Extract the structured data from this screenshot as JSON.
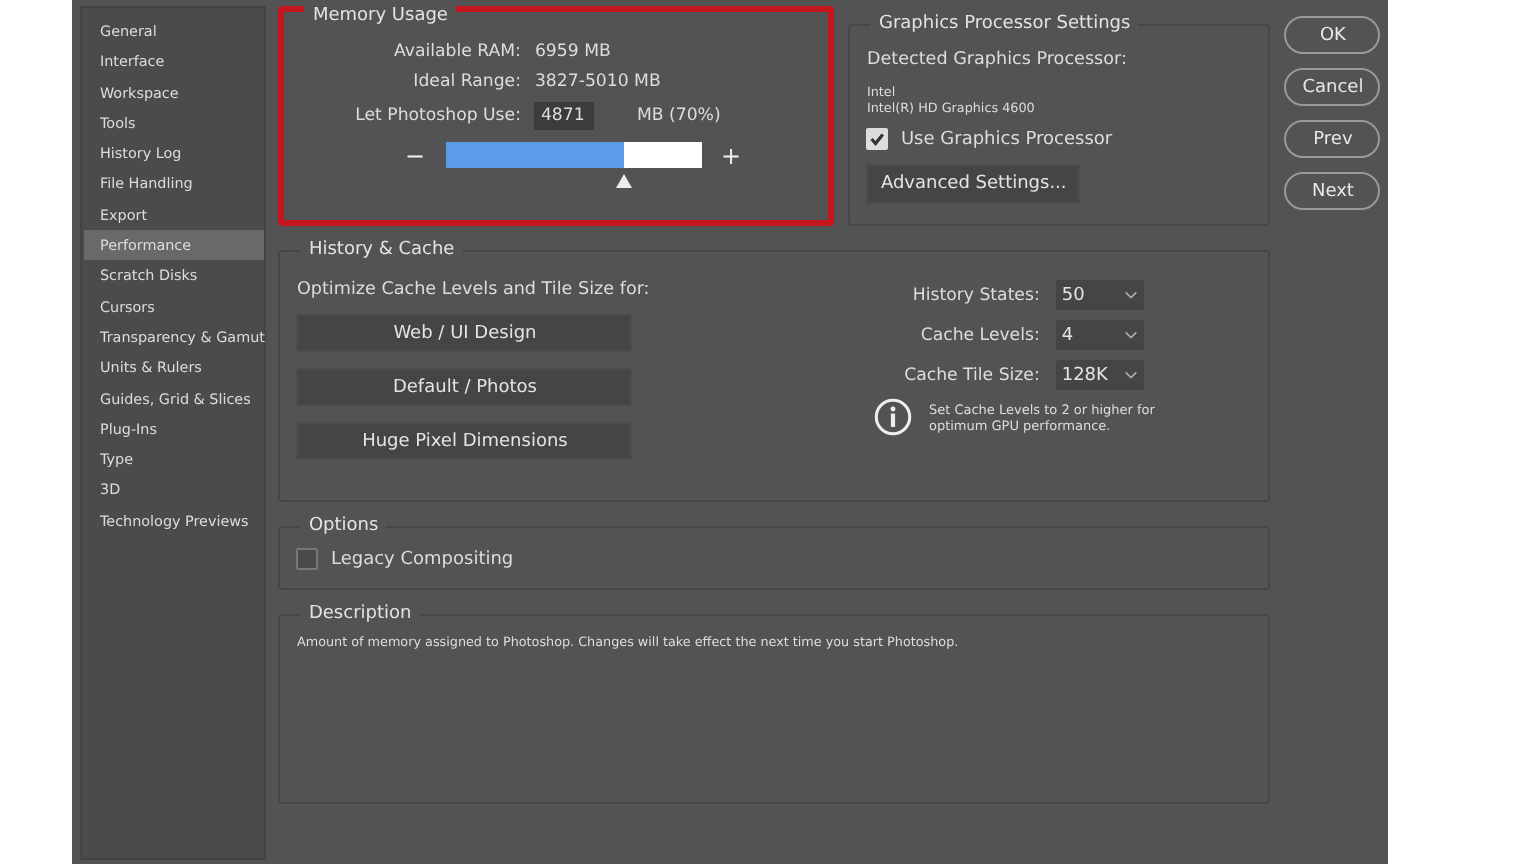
{
  "sidebar": {
    "items": [
      {
        "label": "General",
        "selected": false
      },
      {
        "label": "Interface",
        "selected": false
      },
      {
        "label": "Workspace",
        "selected": false
      },
      {
        "label": "Tools",
        "selected": false
      },
      {
        "label": "History Log",
        "selected": false
      },
      {
        "label": "File Handling",
        "selected": false
      },
      {
        "label": "Export",
        "selected": false
      },
      {
        "label": "Performance",
        "selected": true
      },
      {
        "label": "Scratch Disks",
        "selected": false
      },
      {
        "label": "Cursors",
        "selected": false
      },
      {
        "label": "Transparency & Gamut",
        "selected": false
      },
      {
        "label": "Units & Rulers",
        "selected": false
      },
      {
        "label": "Guides, Grid & Slices",
        "selected": false
      },
      {
        "label": "Plug-Ins",
        "selected": false
      },
      {
        "label": "Type",
        "selected": false
      },
      {
        "label": "3D",
        "selected": false
      },
      {
        "label": "Technology Previews",
        "selected": false
      }
    ]
  },
  "memory_usage": {
    "title": "Memory Usage",
    "highlighted": true,
    "rows": [
      {
        "label": "Available RAM:",
        "value": "6959 MB"
      },
      {
        "label": "Ideal Range:",
        "value": "3827-5010 MB"
      }
    ],
    "use_label": "Let Photoshop Use:",
    "use_value": "4871",
    "use_unit": "MB (70%)",
    "minus": "−",
    "plus": "+",
    "level": 0.7
  },
  "graphics_processor": {
    "title": "Graphics Processor Settings",
    "detected_label": "Detected Graphics Processor:",
    "vendor": "Intel",
    "model": "Intel(R) HD Graphics 4600",
    "use_gpu": {
      "label": "Use Graphics Processor",
      "checked": true
    },
    "advanced_button": "Advanced Settings..."
  },
  "buttons": [
    "OK",
    "Cancel",
    "Prev",
    "Next"
  ],
  "history_cache": {
    "title": "History & Cache",
    "optimize_label": "Optimize Cache Levels and Tile Size for:",
    "presets": [
      "Web / UI Design",
      "Default / Photos",
      "Huge Pixel Dimensions"
    ],
    "fields": [
      {
        "label": "History States:",
        "value": "50"
      },
      {
        "label": "Cache Levels:",
        "value": "4"
      },
      {
        "label": "Cache Tile Size:",
        "value": "128K"
      }
    ],
    "info": "Set Cache Levels to 2 or higher for optimum GPU performance."
  },
  "options": {
    "title": "Options",
    "items": [
      {
        "label": "Legacy Compositing",
        "checked": false
      }
    ]
  },
  "description": {
    "title": "Description",
    "text": "Amount of memory assigned to Photoshop. Changes will take effect the next time you start Photoshop."
  }
}
